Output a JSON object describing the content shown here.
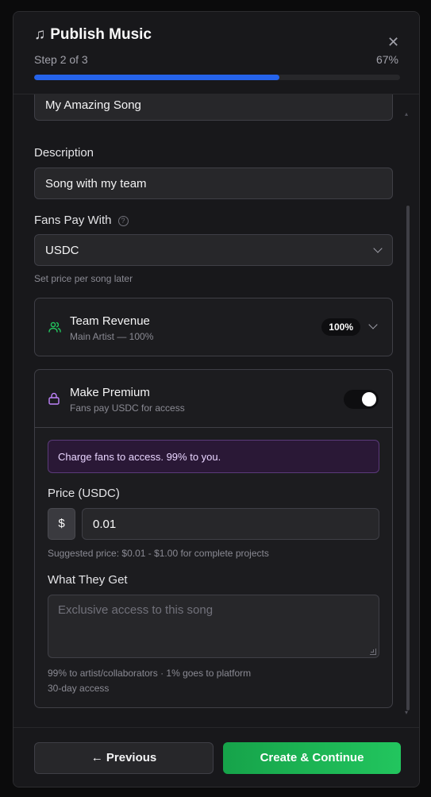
{
  "header": {
    "icon": "music-note-icon",
    "title": "Publish Music",
    "step_text": "Step 2 of 3",
    "step_percent": "67%",
    "progress": 0.67
  },
  "form": {
    "title_value": "My Amazing Song",
    "description_label": "Description",
    "description_value": "Song with my team",
    "fans_pay_label": "Fans Pay With",
    "currency_value": "USDC",
    "currency_hint": "Set price per song later"
  },
  "team_revenue": {
    "title": "Team Revenue",
    "subtitle": "Main Artist — 100%",
    "badge": "100%"
  },
  "premium": {
    "title": "Make Premium",
    "subtitle": "Fans pay USDC for access",
    "enabled": true,
    "notice": "Charge fans to access. 99% to you.",
    "price_label": "Price (USDC)",
    "currency_symbol": "$",
    "price_value": "0.01",
    "price_hint": "Suggested price: $0.01 - $1.00 for complete projects",
    "benefits_label": "What They Get",
    "benefits_placeholder": "Exclusive access to this song",
    "split_note": "99% to artist/collaborators · 1% goes to platform",
    "access_note": "30-day access"
  },
  "footer": {
    "previous_label": "← Previous",
    "next_label": "Create & Continue"
  },
  "colors": {
    "accent_blue": "#2563eb",
    "success_green": "#22c55e",
    "premium_purple": "#c084fc"
  }
}
